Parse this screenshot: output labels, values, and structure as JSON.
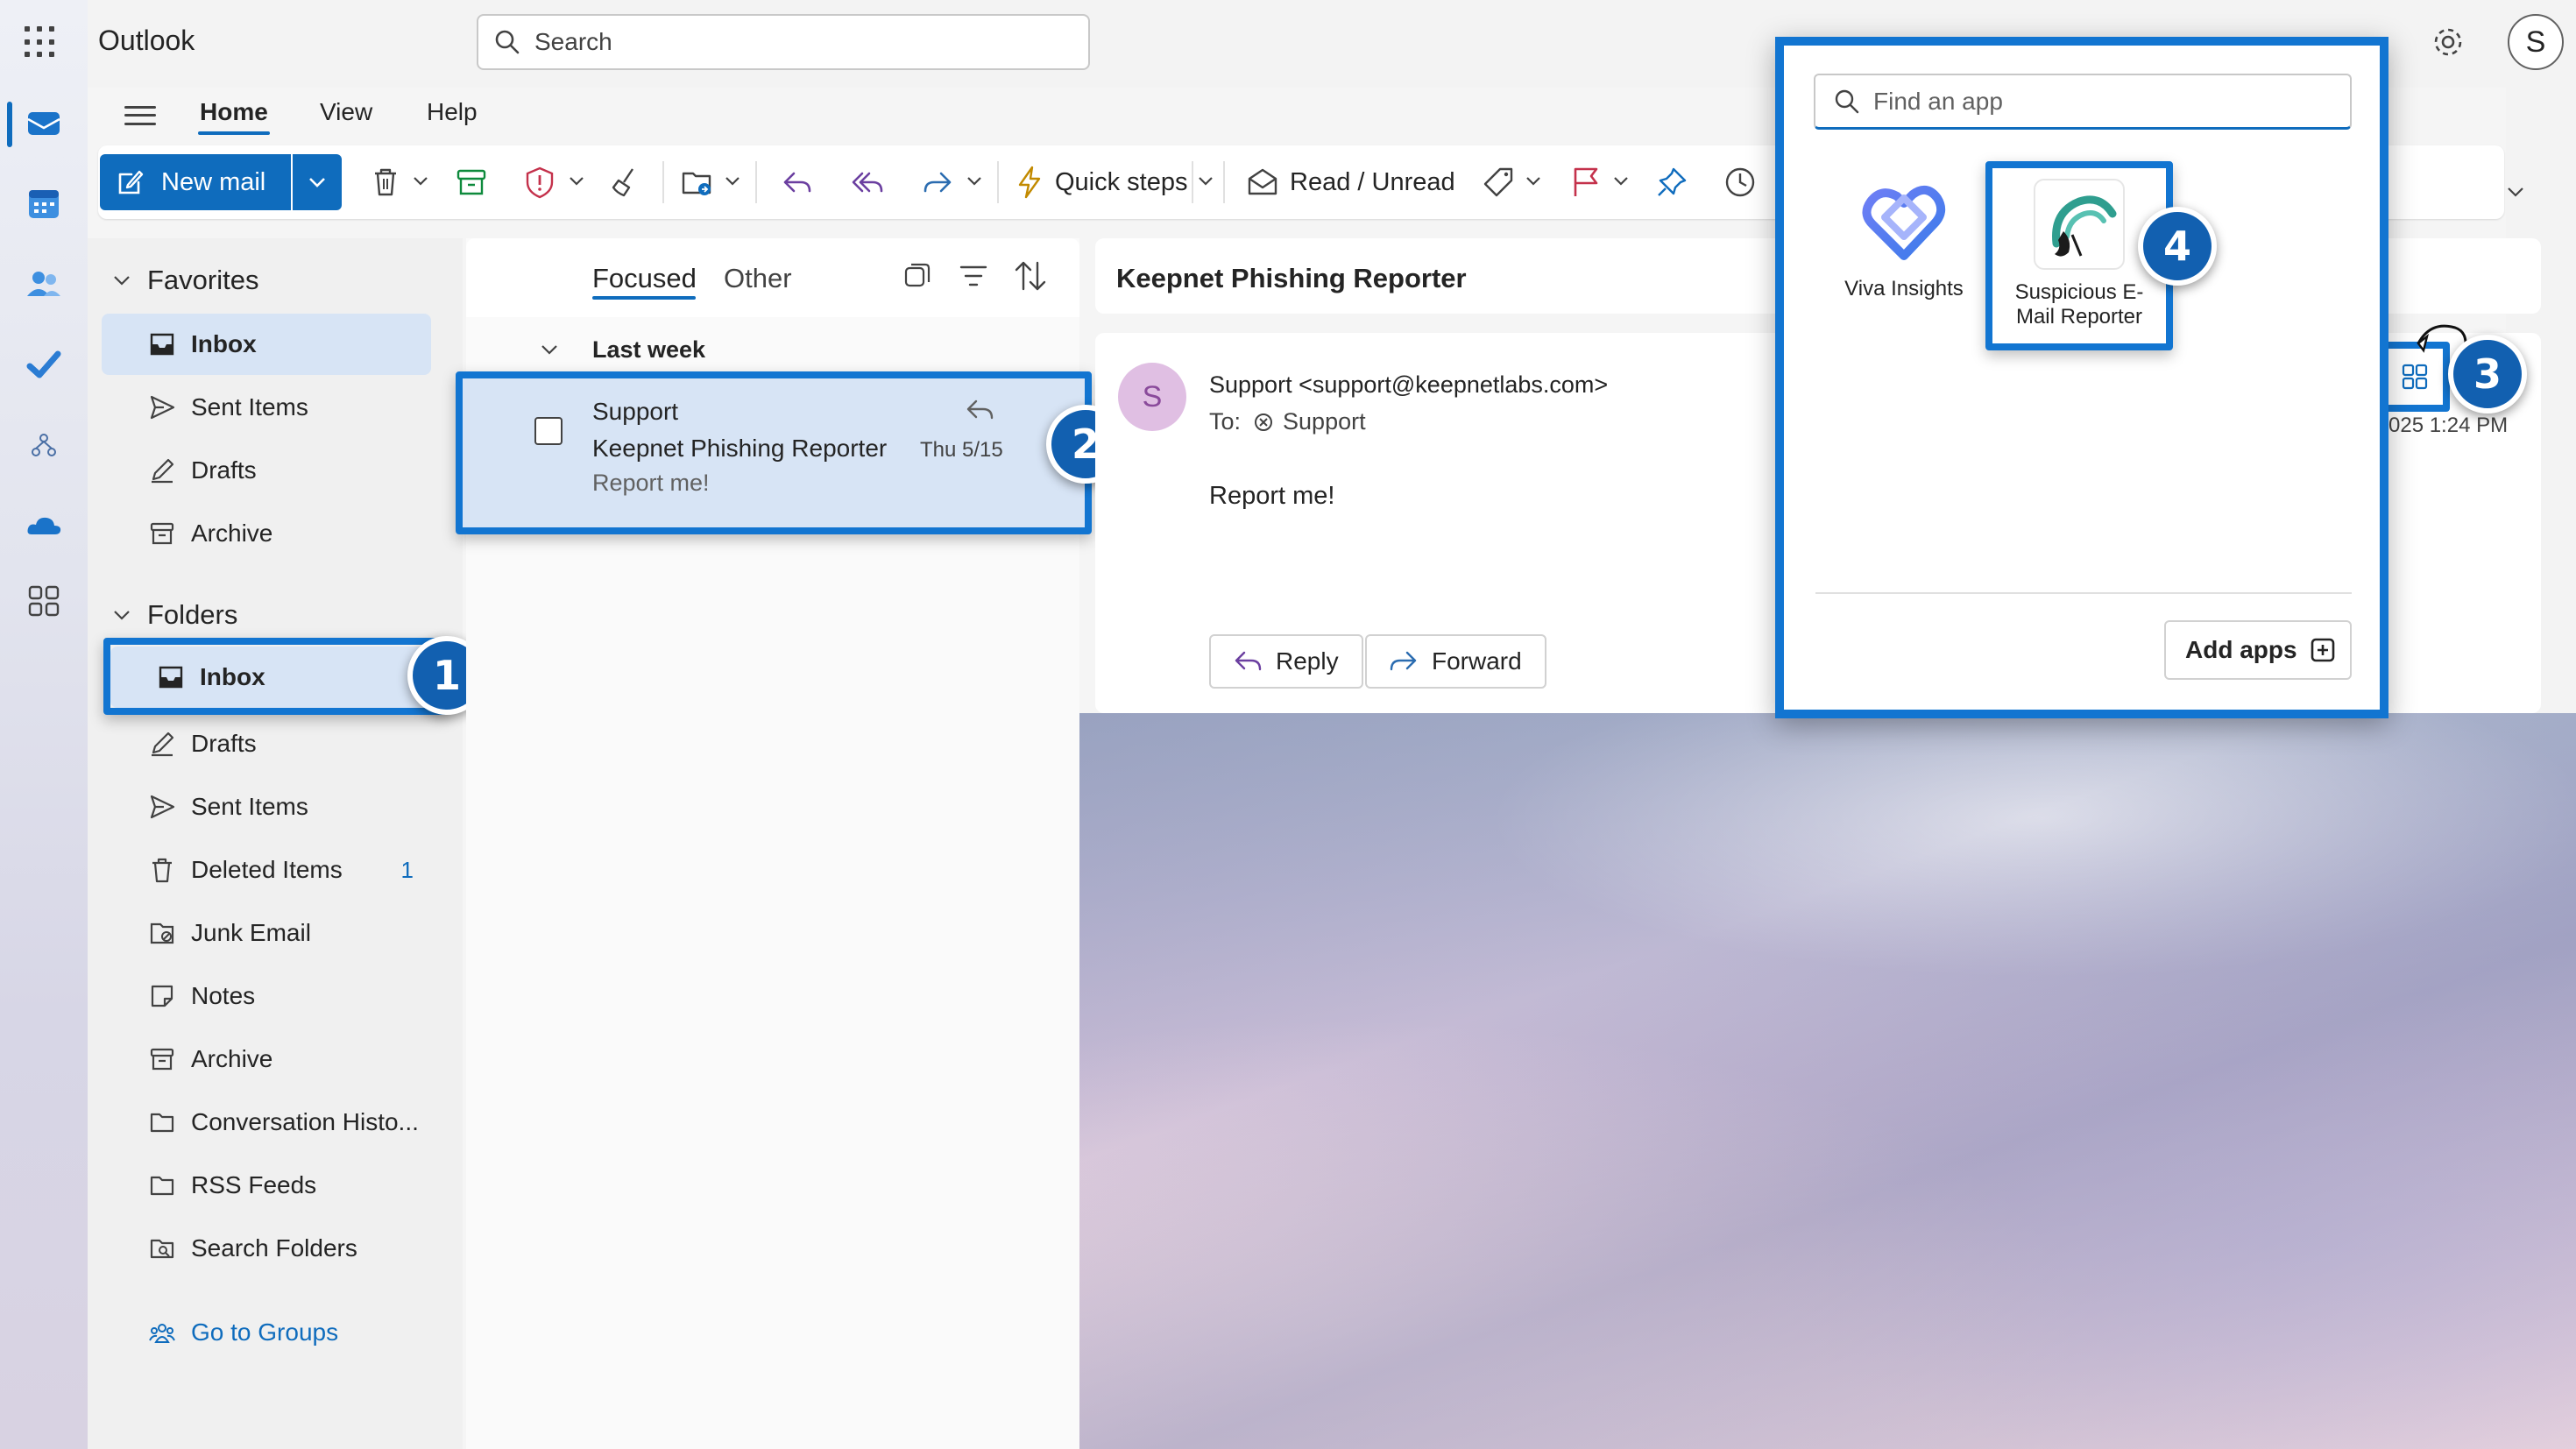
{
  "app": {
    "title": "Outlook",
    "avatar_initial": "S"
  },
  "search": {
    "placeholder": "Search"
  },
  "nav": {
    "tabs": [
      {
        "label": "Home",
        "active": true
      },
      {
        "label": "View",
        "active": false
      },
      {
        "label": "Help",
        "active": false
      }
    ]
  },
  "ribbon": {
    "new_mail": "New mail",
    "quick_steps": "Quick steps",
    "read_unread": "Read / Unread"
  },
  "favorites": {
    "title": "Favorites",
    "items": [
      {
        "label": "Inbox",
        "icon": "inbox-icon",
        "selected": true
      },
      {
        "label": "Sent Items",
        "icon": "send-icon"
      },
      {
        "label": "Drafts",
        "icon": "pencil-icon"
      },
      {
        "label": "Archive",
        "icon": "archive-icon"
      }
    ]
  },
  "folders": {
    "title": "Folders",
    "items": [
      {
        "label": "Inbox",
        "icon": "inbox-icon",
        "selected": true
      },
      {
        "label": "Drafts",
        "icon": "pencil-icon"
      },
      {
        "label": "Sent Items",
        "icon": "send-icon"
      },
      {
        "label": "Deleted Items",
        "icon": "trash-icon",
        "count": "1"
      },
      {
        "label": "Junk Email",
        "icon": "junk-icon"
      },
      {
        "label": "Notes",
        "icon": "note-icon"
      },
      {
        "label": "Archive",
        "icon": "archive-icon"
      },
      {
        "label": "Conversation Histo...",
        "icon": "folder-icon"
      },
      {
        "label": "RSS Feeds",
        "icon": "folder-icon"
      },
      {
        "label": "Search Folders",
        "icon": "search-folder-icon"
      }
    ],
    "go_to_groups": "Go to Groups"
  },
  "message_list": {
    "tabs": {
      "focused": "Focused",
      "other": "Other"
    },
    "group": "Last week",
    "messages": [
      {
        "sender": "Support",
        "subject": "Keepnet Phishing Reporter",
        "preview": "Report me!",
        "date": "Thu 5/15"
      }
    ]
  },
  "reading_pane": {
    "subject": "Keepnet Phishing Reporter",
    "avatar_initial": "S",
    "from": "Support <support@keepnetlabs.com>",
    "to_label": "To:",
    "to_value": "Support",
    "timestamp_partial": "025 1:24 PM",
    "body": "Report me!",
    "reply": "Reply",
    "forward": "Forward"
  },
  "app_flyout": {
    "find_placeholder": "Find an app",
    "apps": [
      {
        "name": "Viva Insights",
        "icon": "viva-insights-icon"
      },
      {
        "name_line1": "Suspicious E-",
        "name_line2": "Mail Reporter",
        "icon": "suspicious-email-reporter-icon"
      }
    ],
    "add_apps": "Add apps"
  },
  "step_badges": [
    "1",
    "2",
    "3",
    "4"
  ],
  "colors": {
    "accent": "#0f6cbd",
    "highlight": "#1275d1",
    "badge": "#1260b0",
    "selection": "#d7e4f5"
  }
}
